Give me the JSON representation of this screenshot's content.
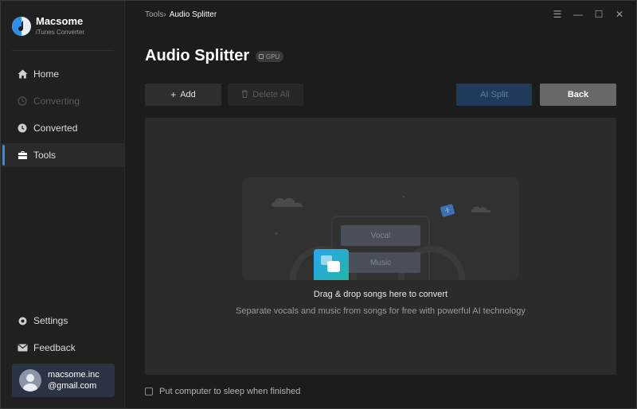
{
  "app": {
    "name": "Macsome",
    "subtitle": "iTunes Converter"
  },
  "sidebar": {
    "items": [
      {
        "label": "Home",
        "icon": "home-icon",
        "state": "normal"
      },
      {
        "label": "Converting",
        "icon": "converting-icon",
        "state": "disabled"
      },
      {
        "label": "Converted",
        "icon": "clock-icon",
        "state": "normal"
      },
      {
        "label": "Tools",
        "icon": "toolbox-icon",
        "state": "active"
      }
    ],
    "bottom_items": [
      {
        "label": "Settings",
        "icon": "gear-icon"
      },
      {
        "label": "Feedback",
        "icon": "mail-icon"
      }
    ],
    "account": {
      "line1": "macsome.inc",
      "line2": "@gmail.com"
    }
  },
  "header": {
    "breadcrumb_parent": "Tools",
    "breadcrumb_separator": "›",
    "breadcrumb_current": "Audio Splitter",
    "window_controls": [
      "menu-icon",
      "minimize-icon",
      "maximize-icon",
      "close-icon"
    ]
  },
  "main": {
    "title": "Audio Splitter",
    "badge": "GPU",
    "buttons": {
      "add": "Add",
      "delete_all": "Delete All",
      "ai_split": "AI Split",
      "back": "Back"
    },
    "illustration": {
      "vocal_label": "Vocal",
      "music_label": "Music"
    },
    "drop_title": "Drag & drop songs here to convert",
    "drop_subtitle": "Separate vocals and music from songs for free with powerful AI technology",
    "sleep_option": "Put computer to sleep when finished",
    "sleep_checked": false
  },
  "colors": {
    "accent": "#2f8fe8",
    "background": "#1c1c1c",
    "sidebar": "#202020",
    "panel": "#2b2b2b"
  }
}
